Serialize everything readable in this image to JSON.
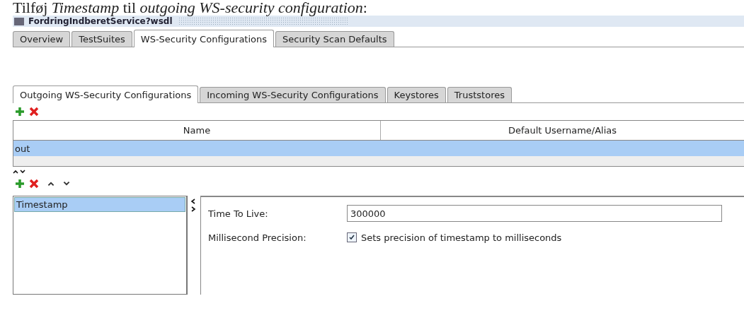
{
  "caption": "Tilføj *Timestamp* til *outgoing WS-security configuration*:",
  "window": {
    "title": "FordringIndberetService?wsdl"
  },
  "tabs": [
    {
      "label": "Overview",
      "selected": false
    },
    {
      "label": "TestSuites",
      "selected": false
    },
    {
      "label": "WS-Security Configurations",
      "selected": true
    },
    {
      "label": "Security Scan Defaults",
      "selected": false
    }
  ],
  "security_tabs": [
    {
      "label": "Outgoing WS-Security Configurations",
      "selected": true
    },
    {
      "label": "Incoming WS-Security Configurations",
      "selected": false
    },
    {
      "label": "Keystores",
      "selected": false
    },
    {
      "label": "Truststores",
      "selected": false
    }
  ],
  "table": {
    "columns": [
      "Name",
      "Default Username/Alias"
    ],
    "rows": [
      {
        "name": "out",
        "selected": true
      }
    ]
  },
  "entries": [
    {
      "label": "Timestamp",
      "selected": true
    }
  ],
  "form": {
    "ttl": {
      "label": "Time To Live:",
      "value": "300000"
    },
    "precision": {
      "label": "Millisecond Precision:",
      "checked": true,
      "text": "Sets precision of timestamp to milliseconds"
    }
  }
}
